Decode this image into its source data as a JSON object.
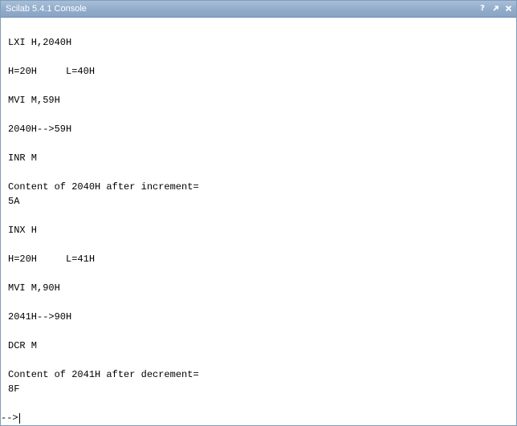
{
  "window": {
    "title": "Scilab 5.4.1 Console"
  },
  "title_controls": {
    "help_glyph": "?",
    "undock_icon": "undock-arrow-icon",
    "close_icon": "close-icon"
  },
  "console": {
    "lines": [
      "LXI H,2040H",
      "",
      "H=20H     L=40H",
      "",
      "MVI M,59H",
      "",
      "2040H-->59H",
      "",
      "INR M",
      "",
      "Content of 2040H after increment=",
      "5A",
      "",
      "INX H",
      "",
      "H=20H     L=41H",
      "",
      "MVI M,90H",
      "",
      "2041H-->90H",
      "",
      "DCR M",
      "",
      "Content of 2041H after decrement=",
      "8F"
    ],
    "prompt": "-->"
  }
}
